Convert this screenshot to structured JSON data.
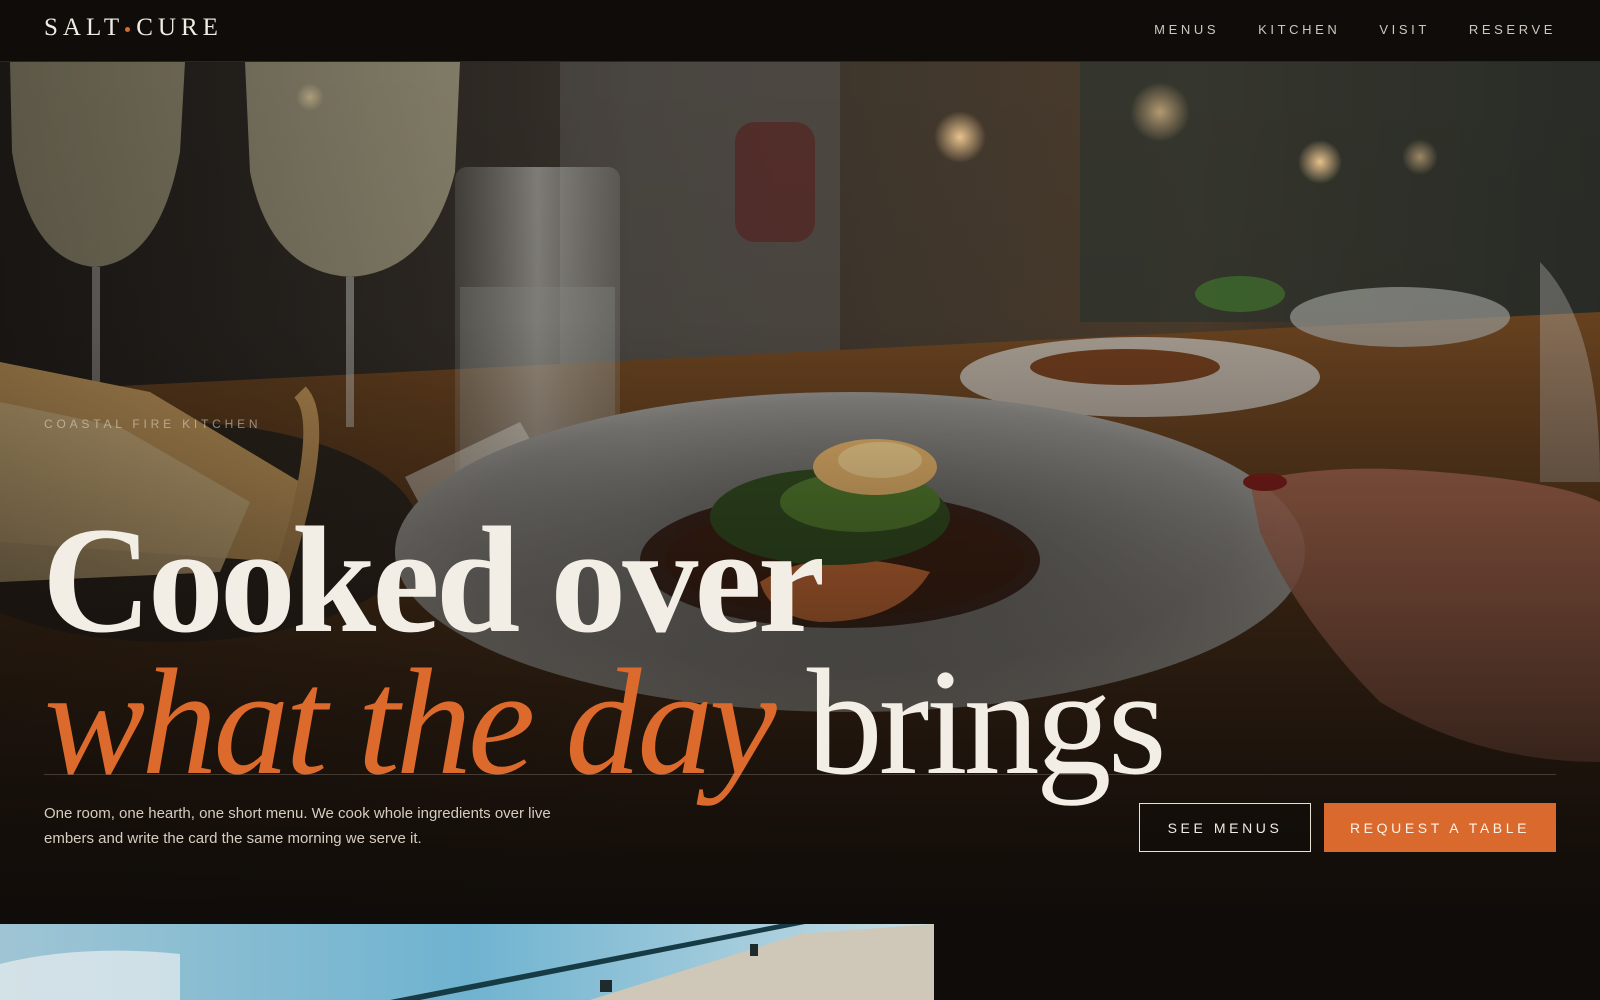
{
  "brand": {
    "name_left": "SALT",
    "name_right": "CURE",
    "accent_color": "#dc6a2c"
  },
  "nav": {
    "items": [
      "MENUS",
      "KITCHEN",
      "VISIT",
      "RESERVE"
    ]
  },
  "hero": {
    "eyebrow": "COASTAL FIRE KITCHEN",
    "headline_line1": "Cooked over",
    "headline_accent": "what the day",
    "headline_tail": "brings",
    "lede": "One room, one hearth, one short menu. We cook whole ingredients over live embers and write the card the same morning we serve it.",
    "primary_button": "REQUEST A TABLE",
    "secondary_button": "SEE MENUS"
  },
  "colors": {
    "background": "#100c09",
    "text": "#f3eee5",
    "accent": "#dc6a2c"
  }
}
